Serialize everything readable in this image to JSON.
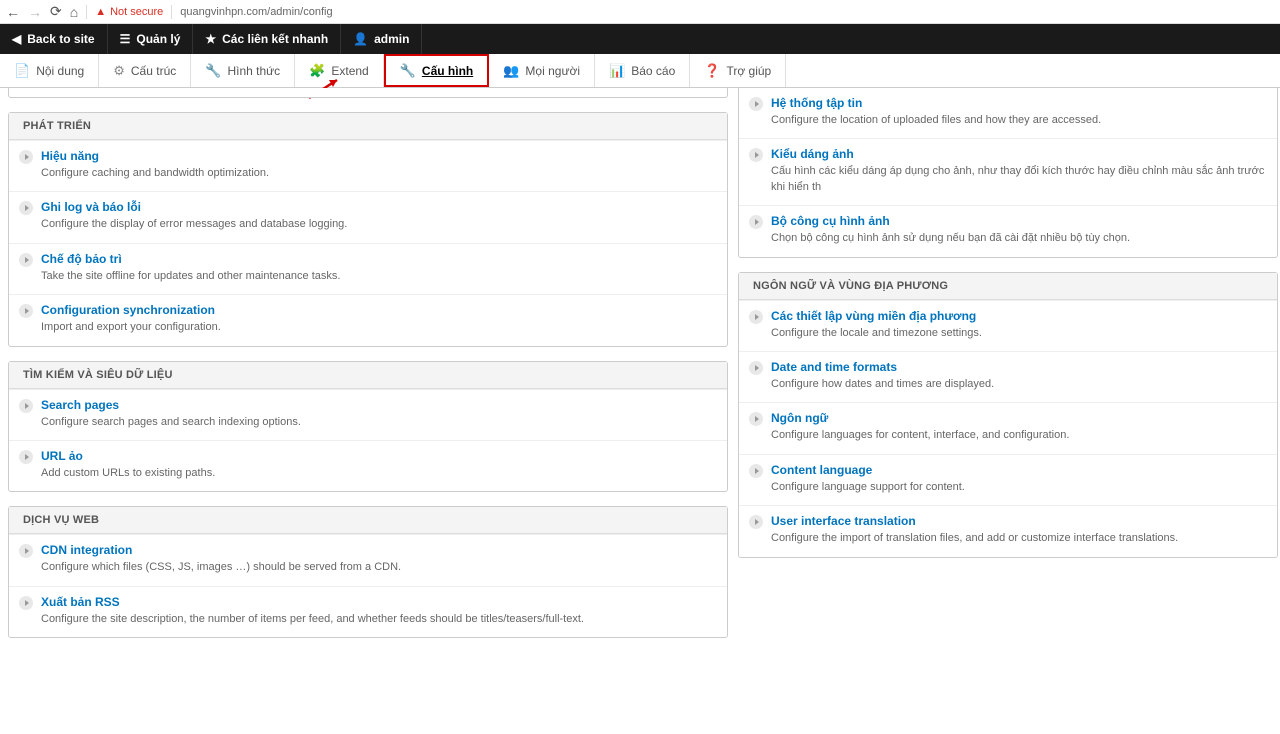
{
  "browser": {
    "not_secure": "Not secure",
    "url": "quangvinhpn.com/admin/config"
  },
  "topbar": {
    "back": "Back to site",
    "manage": "Quản lý",
    "quicklinks": "Các liên kết nhanh",
    "user": "admin"
  },
  "tabs": {
    "content": "Nội dung",
    "structure": "Cấu trúc",
    "appearance": "Hình thức",
    "extend": "Extend",
    "config": "Cấu hình",
    "people": "Mọi người",
    "reports": "Báo cáo",
    "help": "Trợ giúp"
  },
  "sections": {
    "dev": {
      "title": "PHÁT TRIỂN",
      "items": [
        {
          "t": "Hiệu năng",
          "d": "Configure caching and bandwidth optimization."
        },
        {
          "t": "Ghi log và báo lỗi",
          "d": "Configure the display of error messages and database logging."
        },
        {
          "t": "Chế độ bảo trì",
          "d": "Take the site offline for updates and other maintenance tasks."
        },
        {
          "t": "Configuration synchronization",
          "d": "Import and export your configuration."
        }
      ]
    },
    "search": {
      "title": "TÌM KIẾM VÀ SIÊU DỮ LIỆU",
      "items": [
        {
          "t": "Search pages",
          "d": "Configure search pages and search indexing options."
        },
        {
          "t": "URL ảo",
          "d": "Add custom URLs to existing paths."
        }
      ]
    },
    "web": {
      "title": "DỊCH VỤ WEB",
      "items": [
        {
          "t": "CDN integration",
          "d": "Configure which files (CSS, JS, images …) should be served from a CDN."
        },
        {
          "t": "Xuất bản RSS",
          "d": "Configure the site description, the number of items per feed, and whether feeds should be titles/teasers/full-text."
        }
      ]
    },
    "media": {
      "items": [
        {
          "t": "Hệ thống tập tin",
          "d": "Configure the location of uploaded files and how they are accessed."
        },
        {
          "t": "Kiểu dáng ảnh",
          "d": "Cấu hình các kiểu dáng áp dụng cho ảnh, như thay đổi kích thước hay điều chỉnh màu sắc ảnh trước khi hiển th"
        },
        {
          "t": "Bộ công cụ hình ảnh",
          "d": "Chọn bộ công cụ hình ảnh sử dụng nếu bạn đã cài đặt nhiều bộ tùy chọn."
        }
      ]
    },
    "region": {
      "title": "NGÔN NGỮ VÀ VÙNG ĐỊA PHƯƠNG",
      "items": [
        {
          "t": "Các thiết lập vùng miền địa phương",
          "d": "Configure the locale and timezone settings."
        },
        {
          "t": "Date and time formats",
          "d": "Configure how dates and times are displayed."
        },
        {
          "t": "Ngôn ngữ",
          "d": "Configure languages for content, interface, and configuration."
        },
        {
          "t": "Content language",
          "d": "Configure language support for content."
        },
        {
          "t": "User interface translation",
          "d": "Configure the import of translation files, and add or customize interface translations."
        }
      ]
    }
  }
}
